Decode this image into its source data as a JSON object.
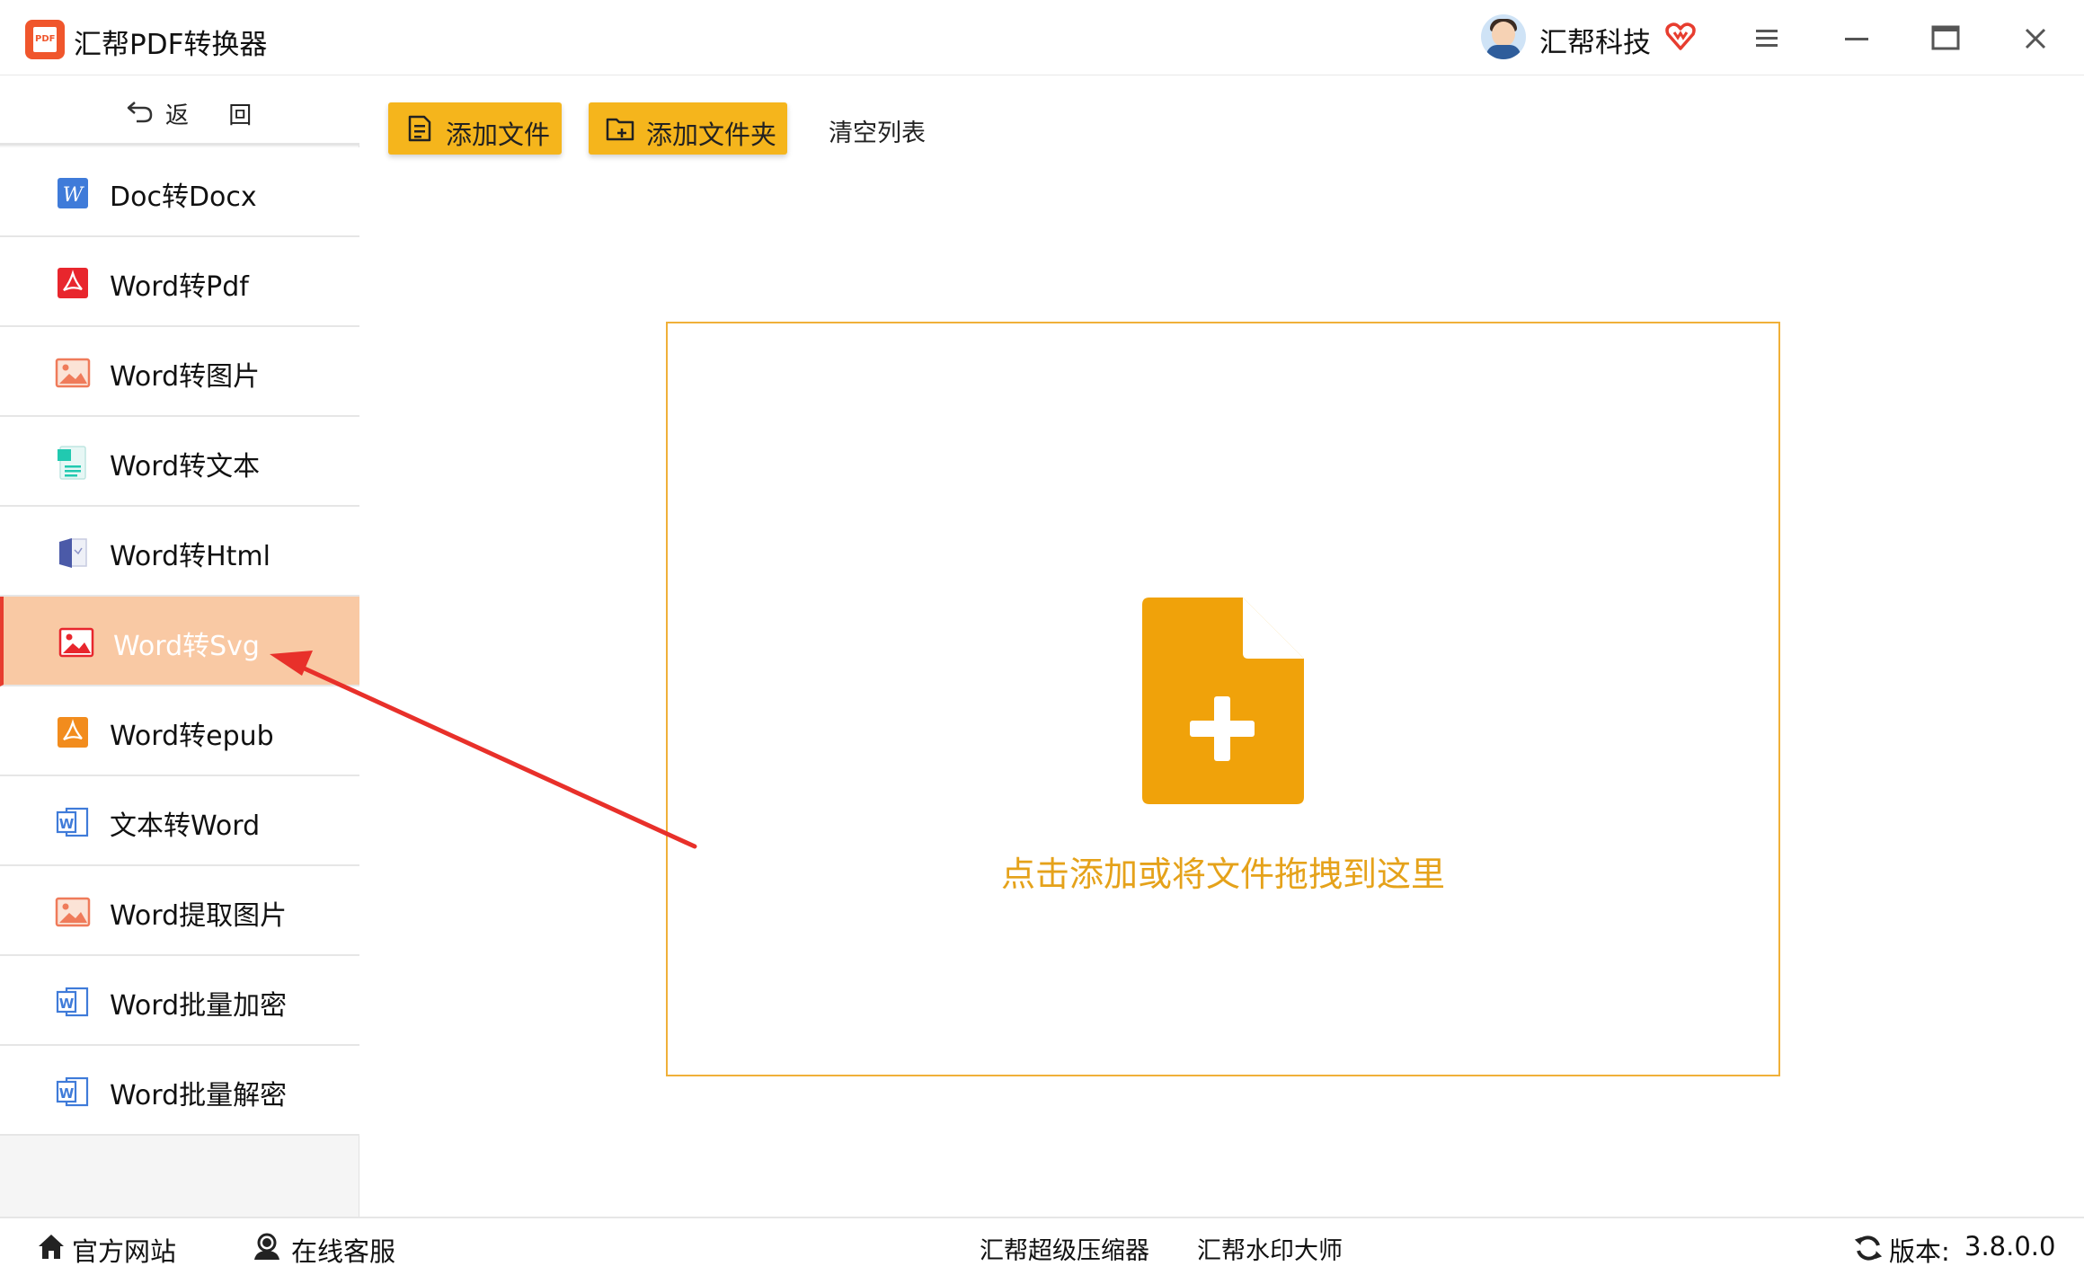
{
  "titlebar": {
    "app_title": "汇帮PDF转换器",
    "logo_text": "PDF",
    "user_name": "汇帮科技",
    "icons": [
      "app-logo-icon",
      "avatar",
      "vip-heart-icon",
      "menu-icon",
      "minimize-icon",
      "maximize-icon",
      "close-icon"
    ]
  },
  "sidebar": {
    "back_label": "返 回",
    "items": [
      {
        "label": "Doc转Docx",
        "icon": "word-w-icon"
      },
      {
        "label": "Word转Pdf",
        "icon": "pdf-acrobat-icon"
      },
      {
        "label": "Word转图片",
        "icon": "image-icon"
      },
      {
        "label": "Word转文本",
        "icon": "text-doc-icon"
      },
      {
        "label": "Word转Html",
        "icon": "html-doc-icon"
      },
      {
        "label": "Word转Svg",
        "icon": "svg-image-icon",
        "active": true
      },
      {
        "label": "Word转epub",
        "icon": "epub-icon"
      },
      {
        "label": "文本转Word",
        "icon": "word-outline-icon"
      },
      {
        "label": "Word提取图片",
        "icon": "image-icon"
      },
      {
        "label": "Word批量加密",
        "icon": "word-outline-icon"
      },
      {
        "label": "Word批量解密",
        "icon": "word-outline-icon"
      }
    ]
  },
  "toolbar": {
    "add_file_label": "添加文件",
    "add_folder_label": "添加文件夹",
    "clear_label": "清空列表"
  },
  "dropzone": {
    "text": "点击添加或将文件拖拽到这里"
  },
  "footer": {
    "official_site": "官方网站",
    "online_service": "在线客服",
    "compressor": "汇帮超级压缩器",
    "watermark": "汇帮水印大师",
    "version_label": "版本:",
    "version_value": "3.8.0.0"
  },
  "colors": {
    "accent_yellow": "#f5b51c",
    "drop_orange": "#f0a20a",
    "drop_text": "#e5a21a",
    "active_item_bg": "#f9c9a4",
    "arrow_red": "#e8302a"
  }
}
